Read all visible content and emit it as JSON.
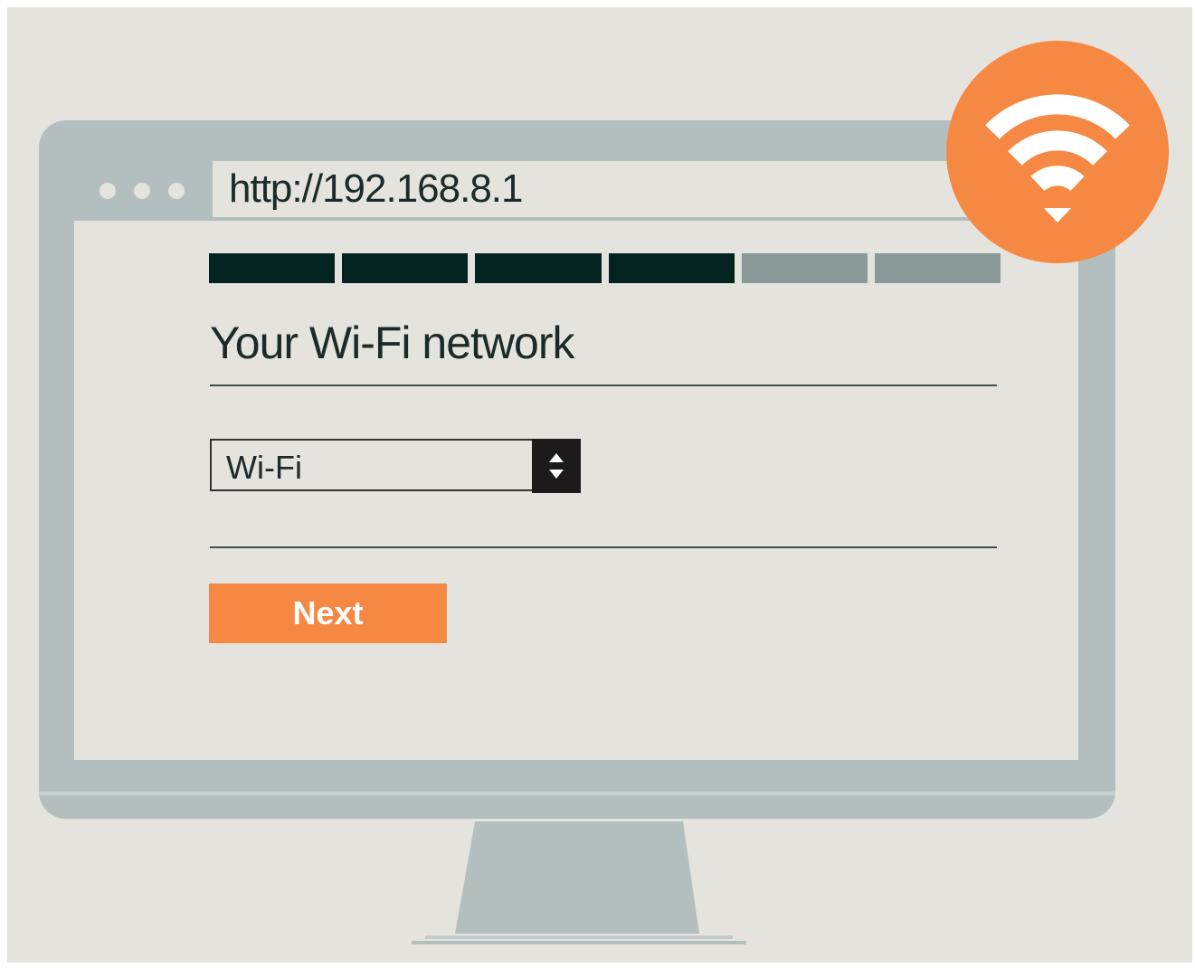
{
  "browser": {
    "url": "http://192.168.8.1",
    "window_dots": 3
  },
  "setup": {
    "progress": {
      "completed_steps": 4,
      "total_steps": 6
    },
    "title": "Your Wi-Fi network",
    "network_select": {
      "selected": "Wi-Fi"
    },
    "next_label": "Next"
  },
  "icons": {
    "badge": "wifi-icon",
    "stepper": "up-down-arrows-icon"
  },
  "colors": {
    "accent": "#f58943",
    "progress_done": "#032321",
    "progress_todo": "#889997",
    "monitor": "#b3bfbf",
    "background": "#e5e3de"
  }
}
